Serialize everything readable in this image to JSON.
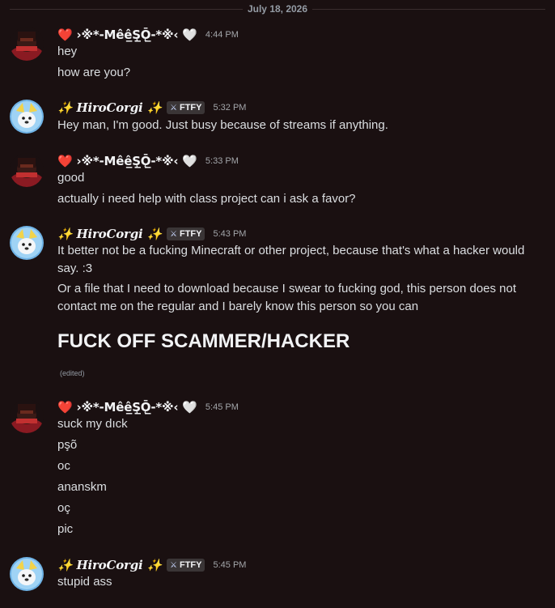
{
  "date_divider": "July 18, 2026",
  "users": {
    "mese": {
      "name": "❤️ ›※*-Mêê̲Ş̲Ǭ̲-*※‹ 🤍",
      "avatar_icon": "dark-red-hooded-avatar-icon"
    },
    "hiro": {
      "name": "✨ HiroCorgi ✨",
      "badge": "FTFY",
      "badge_icon": "sword-icon",
      "avatar_icon": "blue-corgi-avatar-icon"
    }
  },
  "groups": [
    {
      "time": "4:44 PM",
      "lines": [
        "hey",
        "how are you?"
      ]
    },
    {
      "time": "5:32 PM",
      "lines": [
        "Hey man, I'm good. Just busy because of streams if anything."
      ]
    },
    {
      "time": "5:33 PM",
      "lines": [
        "good",
        "actually i need help with  class project can i ask a favor?"
      ]
    },
    {
      "time": "5:43 PM",
      "lines": [
        "It better not be a fucking Minecraft or other project, because that's what a hacker would say. :3",
        "Or a file that I need to download because I swear to fucking god, this person does not contact me on the regular and I barely know this person so you can"
      ],
      "big": "FUCK OFF SCAMMER/HACKER",
      "edited": "(edited)"
    },
    {
      "time": "5:45 PM",
      "lines": [
        "suck my dıck",
        "pşõ",
        "oc",
        "ananskm",
        "oç",
        "pic"
      ]
    },
    {
      "time": "5:45 PM",
      "lines": [
        "stupid ass"
      ]
    }
  ]
}
